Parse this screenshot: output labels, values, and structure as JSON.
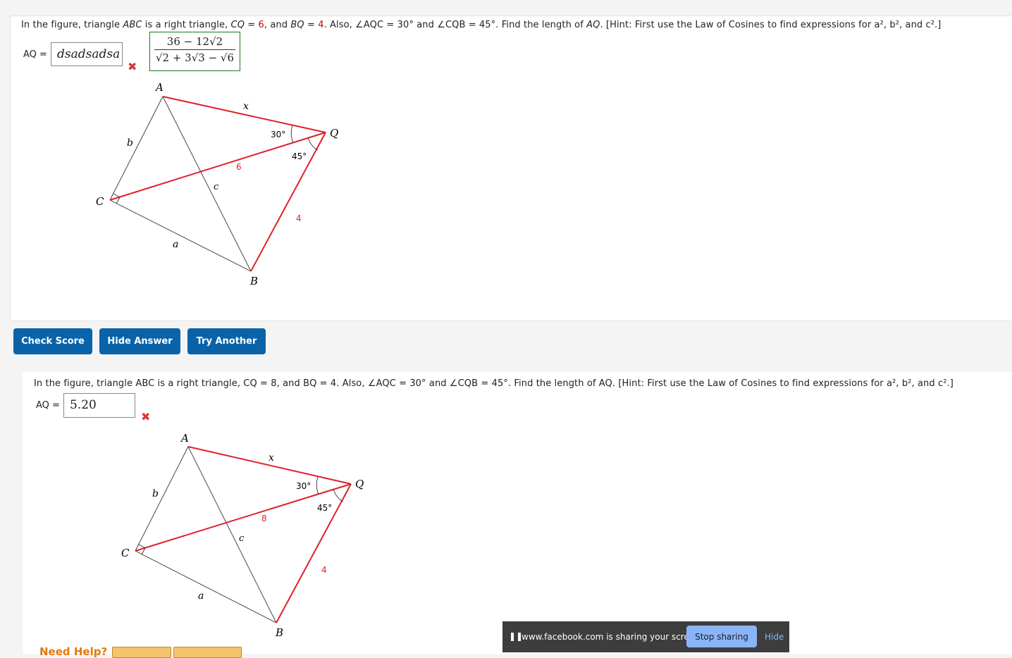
{
  "problem1": {
    "question_pre": "In the figure, triangle ",
    "triangle": "ABC",
    "question_mid1": " is a right triangle, ",
    "cq_label": "CQ",
    "cq_value": "6",
    "bq_label": "BQ",
    "bq_value": "4",
    "question_mid2": ". Also, ∠AQC = 30° and ∠CQB = 45°. Find the length of ",
    "target": "AQ",
    "question_hint": ". [Hint: First use the Law of Cosines to find expressions for a², b², and c².]",
    "answer_label": "AQ =",
    "answer_value": "dsadsadsa",
    "correct_numerator": "36 − 12√2",
    "correct_denominator": "√2 + 3√3 − √6",
    "figure": {
      "A": "A",
      "B": "B",
      "C": "C",
      "Q": "Q",
      "a": "a",
      "b": "b",
      "c": "c",
      "x": "x",
      "side_cq": "6",
      "side_bq": "4",
      "angle_aqc": "30°",
      "angle_cqb": "45°"
    }
  },
  "buttons": {
    "check_score": "Check Score",
    "hide_answer": "Hide Answer",
    "try_another": "Try Another"
  },
  "problem2": {
    "question": "In the figure, triangle ABC is a right triangle, CQ = 8, and BQ = 4. Also, ∠AQC = 30° and ∠CQB = 45°. Find the length of AQ. [Hint: First use the Law of Cosines to find expressions for a², b², and c².]",
    "cq_value": "8",
    "bq_value": "4",
    "answer_label": "AQ =",
    "answer_value": "5.20",
    "figure": {
      "A": "A",
      "B": "B",
      "C": "C",
      "Q": "Q",
      "a": "a",
      "b": "b",
      "c": "c",
      "x": "x",
      "side_cq": "8",
      "side_bq": "4",
      "angle_aqc": "30°",
      "angle_cqb": "45°"
    }
  },
  "need_help": "Need Help?",
  "screen_share": {
    "message": "www.facebook.com is sharing your screen.",
    "stop": "Stop sharing",
    "hide": "Hide"
  },
  "colors": {
    "primary_button": "#0a63a8",
    "error_mark": "#d9383a",
    "figure_red": "#e0202a",
    "correct_border": "#1a7a1a"
  }
}
